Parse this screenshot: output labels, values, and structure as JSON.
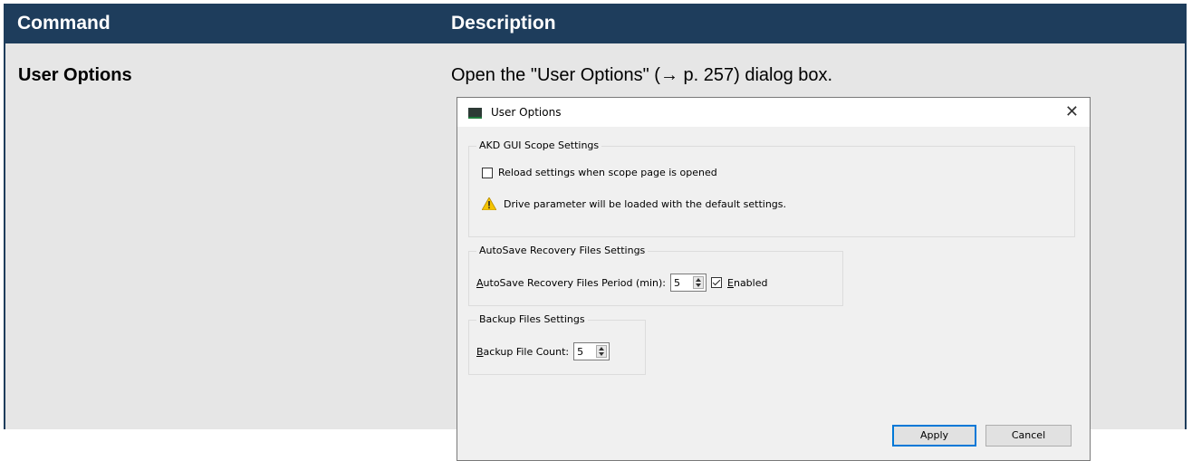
{
  "table": {
    "headers": {
      "command": "Command",
      "description": "Description"
    },
    "row": {
      "command": "User Options",
      "description": "Open the \"User Options\" (→ p. 257) dialog box."
    }
  },
  "dialog": {
    "title": "User Options",
    "close_glyph": "✕",
    "scope_group": {
      "legend": "AKD GUI Scope Settings",
      "reload_checkbox": {
        "label": "Reload settings when scope page is opened",
        "checked": false
      },
      "warning_text": "Drive parameter will be loaded with the default settings."
    },
    "autosave_group": {
      "legend": "AutoSave Recovery Files Settings",
      "period_label_first": "A",
      "period_label_rest": "utoSave Recovery Files Period (min):",
      "period_value": "5",
      "enabled_first": "E",
      "enabled_rest": "nabled",
      "enabled_checked": true
    },
    "backup_group": {
      "legend": "Backup Files Settings",
      "count_label_first": "B",
      "count_label_rest": "ackup File Count:",
      "count_value": "5"
    },
    "buttons": {
      "apply": "Apply",
      "cancel": "Cancel"
    }
  },
  "colors": {
    "header_bg": "#1e3d5c",
    "row_bg": "#e6e6e6",
    "dialog_bg": "#f0f0f0",
    "accent": "#0078d7"
  }
}
